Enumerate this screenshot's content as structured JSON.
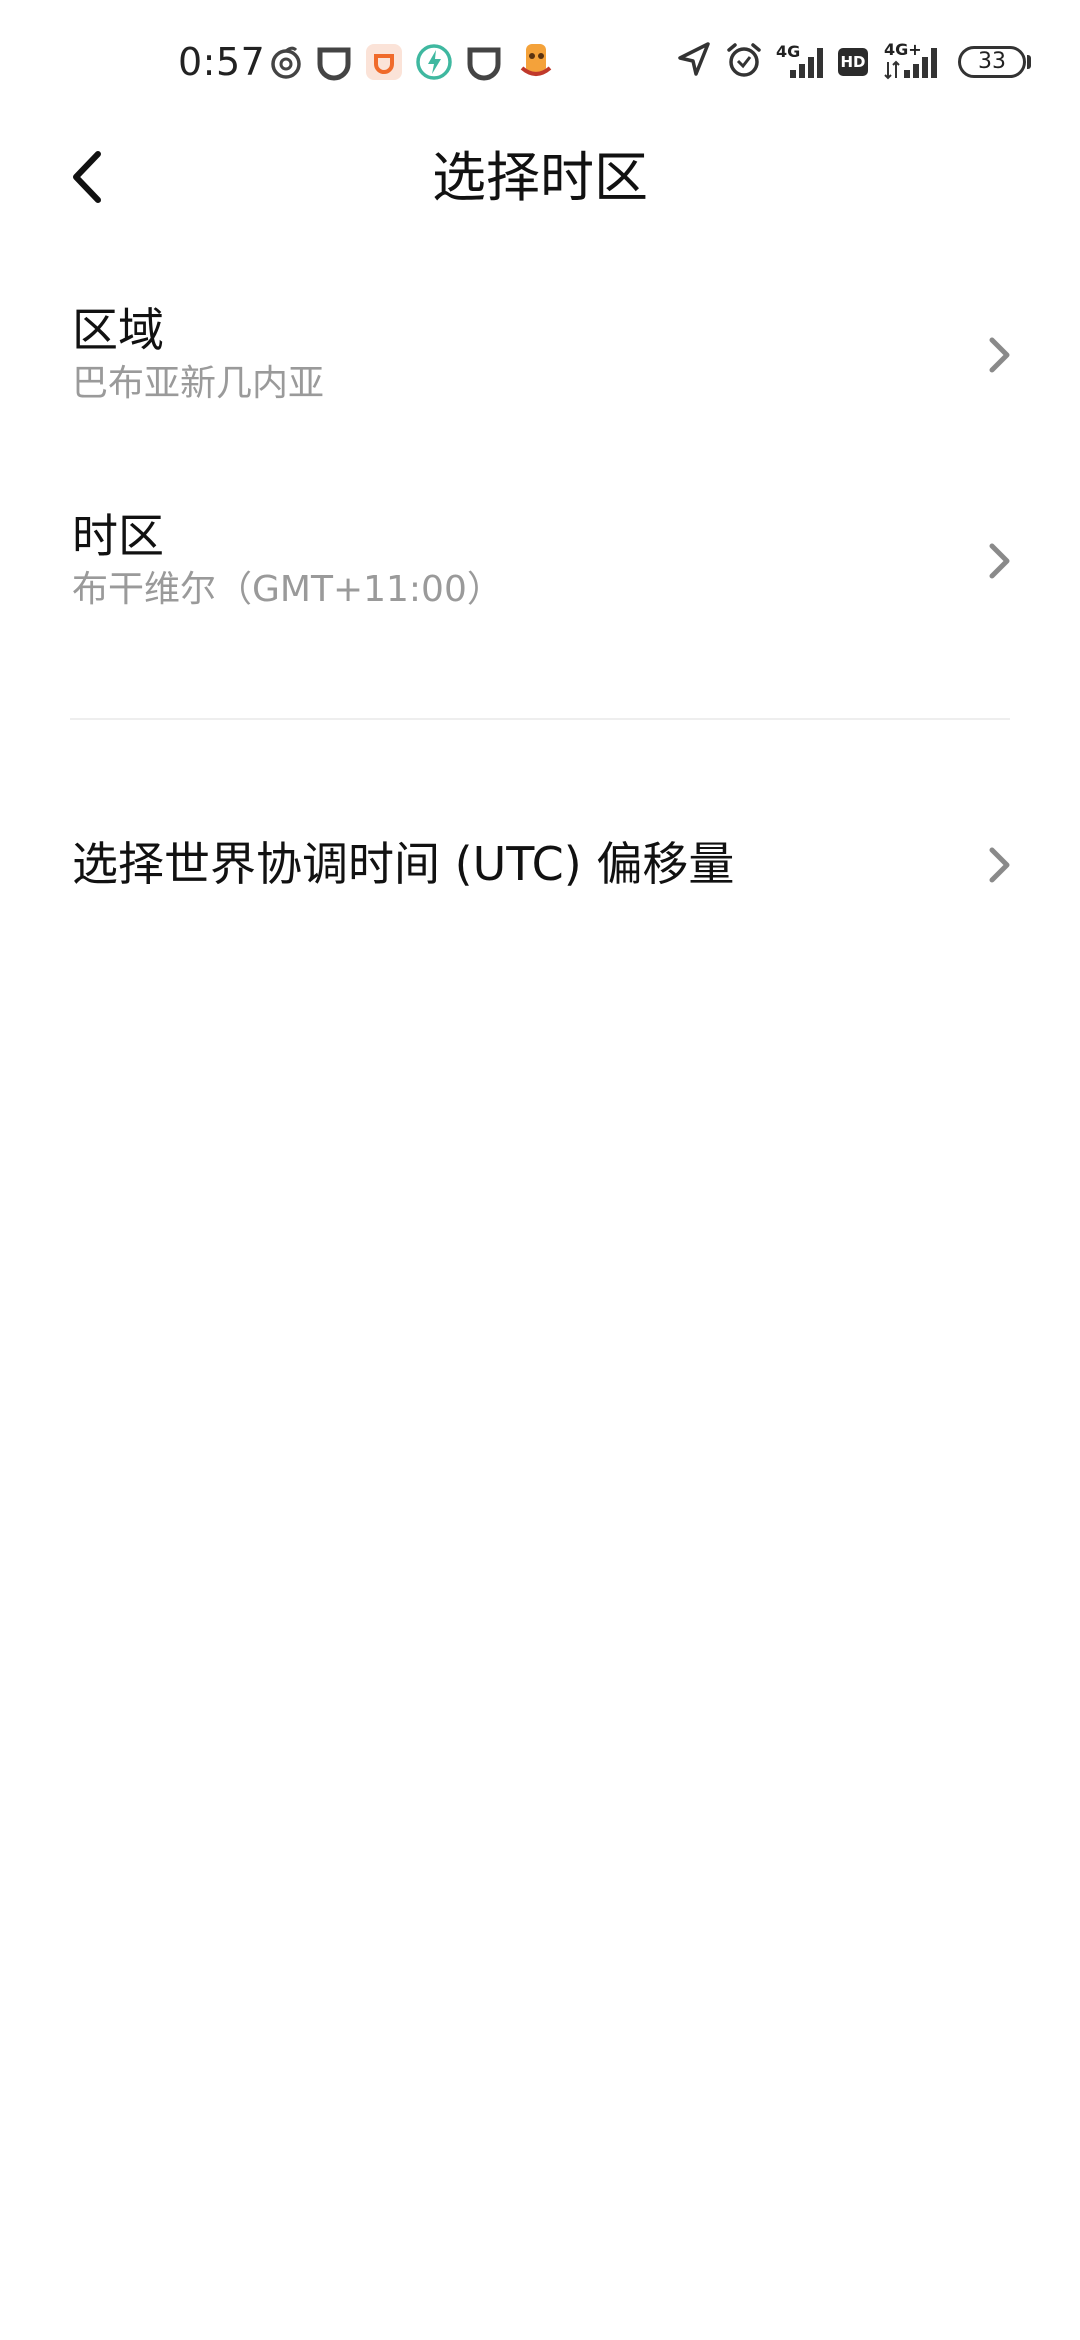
{
  "status_bar": {
    "time": "0:57",
    "network_1": "4G",
    "network_2": "4G+",
    "hd_badge": "HD",
    "battery_level": "33",
    "notification_icons": [
      "netease-music-icon",
      "didi-icon",
      "taobao-icon",
      "charging-app-icon",
      "didi-icon",
      "game-icon"
    ],
    "right_icons": [
      "location-icon",
      "alarm-icon",
      "signal-icon",
      "hd-icon",
      "signal-icon",
      "battery-icon"
    ]
  },
  "header": {
    "title": "选择时区",
    "back_icon": "back-arrow-icon"
  },
  "settings": {
    "region": {
      "title": "区域",
      "value": "巴布亚新几内亚"
    },
    "timezone": {
      "title": "时区",
      "value": "布干维尔（GMT+11:00）"
    },
    "utc_offset": {
      "title": "选择世界协调时间 (UTC) 偏移量"
    }
  },
  "colors": {
    "background": "#ffffff",
    "primary_text": "#111111",
    "secondary_text": "#9a9a9a",
    "chevron": "#8a8a8a",
    "divider": "#eeeeee"
  }
}
